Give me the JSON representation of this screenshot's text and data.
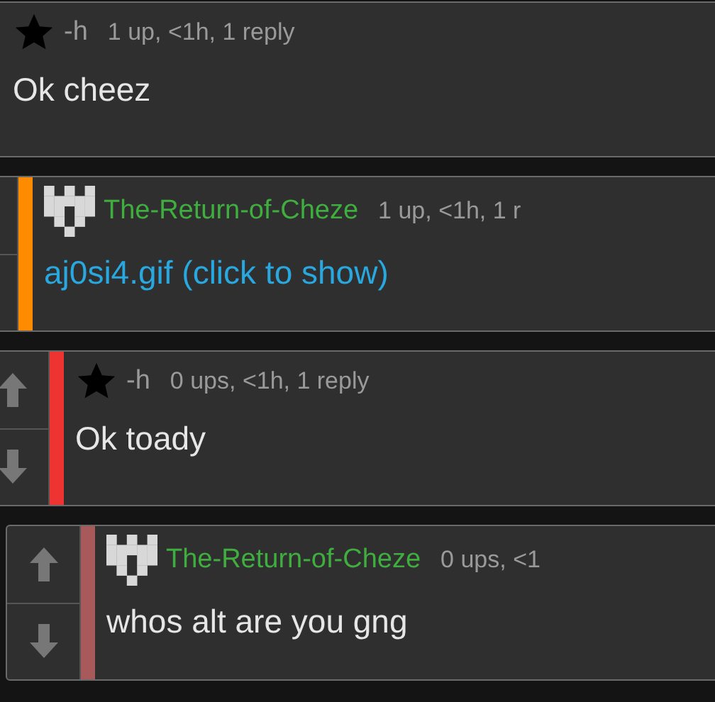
{
  "comments": [
    {
      "author": {
        "kind": "star",
        "name": "-h",
        "color": "#9a9a9a"
      },
      "meta": "1 up, <1h, 1 reply",
      "body": {
        "kind": "text",
        "text": "Ok cheez"
      },
      "children": [
        {
          "author": {
            "kind": "castle",
            "name": "The-Return-of-Cheze",
            "color": "#3fae3f"
          },
          "meta": "1 up, <1h, 1 r",
          "color": "#ff8c00",
          "body": {
            "kind": "link",
            "text": "aj0si4.gif (click to show)"
          },
          "children": [
            {
              "author": {
                "kind": "star",
                "name": "-h",
                "color": "#9a9a9a"
              },
              "meta": "0 ups, <1h, 1 reply",
              "vote_arrows": true,
              "color": "#ee3333",
              "body": {
                "kind": "text",
                "text": "Ok toady"
              },
              "children": [
                {
                  "author": {
                    "kind": "castle",
                    "name": "The-Return-of-Cheze",
                    "color": "#3fae3f"
                  },
                  "meta": "0 ups, <1",
                  "vote_arrows": true,
                  "color": "#a85a5a",
                  "body": {
                    "kind": "text",
                    "text": "whos alt are you gng"
                  }
                }
              ]
            }
          ]
        }
      ]
    }
  ]
}
